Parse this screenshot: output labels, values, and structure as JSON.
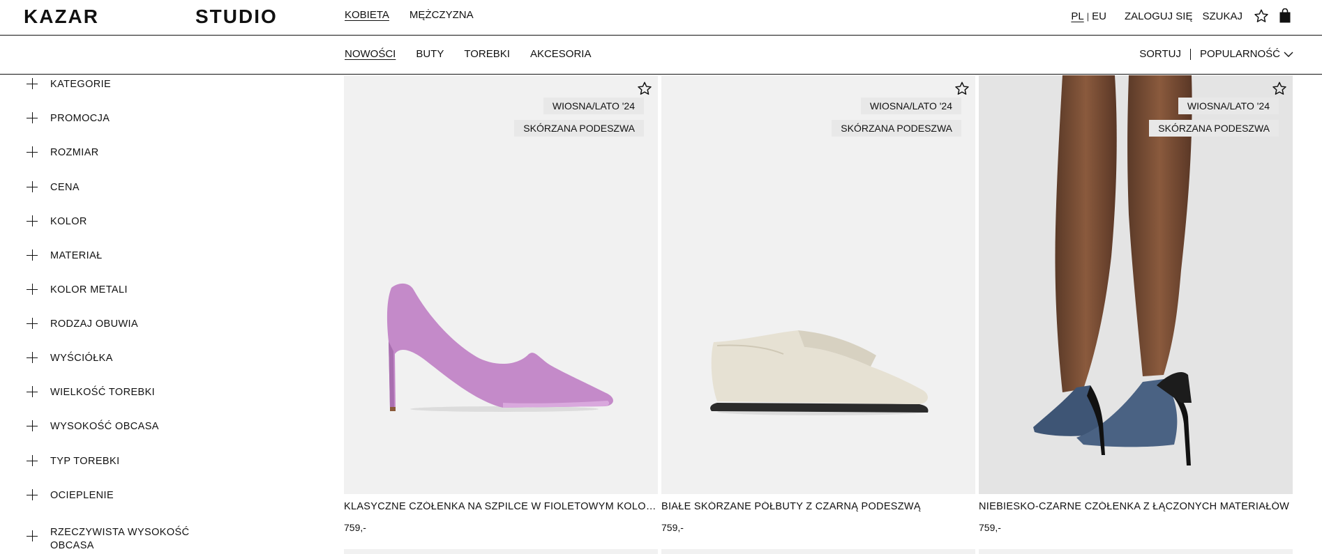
{
  "header": {
    "brand": "KAZAR",
    "sub_brand": "STUDIO",
    "gender_tabs": [
      {
        "label": "KOBIETA",
        "active": true
      },
      {
        "label": "MĘŻCZYZNA",
        "active": false
      }
    ],
    "lang": {
      "current": "PL",
      "separator": "|",
      "alt": "EU"
    },
    "login_label": "ZALOGUJ SIĘ",
    "search_label": "SZUKAJ",
    "icons": {
      "wishlist": "star-outline-icon",
      "cart": "shopping-bag-icon"
    }
  },
  "subnav": {
    "categories": [
      {
        "label": "NOWOŚCI",
        "active": true
      },
      {
        "label": "BUTY",
        "active": false
      },
      {
        "label": "TOREBKI",
        "active": false
      },
      {
        "label": "AKCESORIA",
        "active": false
      }
    ],
    "sort_label": "SORTUJ",
    "sort_value": "POPULARNOŚĆ"
  },
  "filters": [
    "KATEGORIE",
    "PROMOCJA",
    "ROZMIAR",
    "CENA",
    "KOLOR",
    "MATERIAŁ",
    "KOLOR METALI",
    "RODZAJ OBUWIA",
    "WYŚCIÓŁKA",
    "WIELKOŚĆ TOREBKI",
    "WYSOKOŚĆ OBCASA",
    "TYP TOREBKI",
    "OCIEPLENIE",
    "RZECZYWISTA WYSOKOŚĆ OBCASA"
  ],
  "products": [
    {
      "title": "KLASYCZNE CZÓŁENKA NA SZPILCE W FIOLETOWYM KOLORZE",
      "price": "759,-",
      "badges": [
        "WIOSNA/LATO '24",
        "SKÓRZANA PODESZWA"
      ],
      "image": "purple-stiletto-pump",
      "color": "#c48ac9"
    },
    {
      "title": "BIAŁE SKÓRZANE PÓŁBUTY Z CZARNĄ PODESZWĄ",
      "price": "759,-",
      "badges": [
        "WIOSNA/LATO '24",
        "SKÓRZANA PODESZWA"
      ],
      "image": "cream-loafer",
      "color": "#e6e1d3"
    },
    {
      "title": "NIEBIESKO-CZARNE CZÓŁENKA Z ŁĄCZONYCH MATERIAŁÓW",
      "price": "759,-",
      "badges": [
        "WIOSNA/LATO '24",
        "SKÓRZANA PODESZWA"
      ],
      "image": "denim-pumps-on-model",
      "color": "#3e5575"
    }
  ]
}
